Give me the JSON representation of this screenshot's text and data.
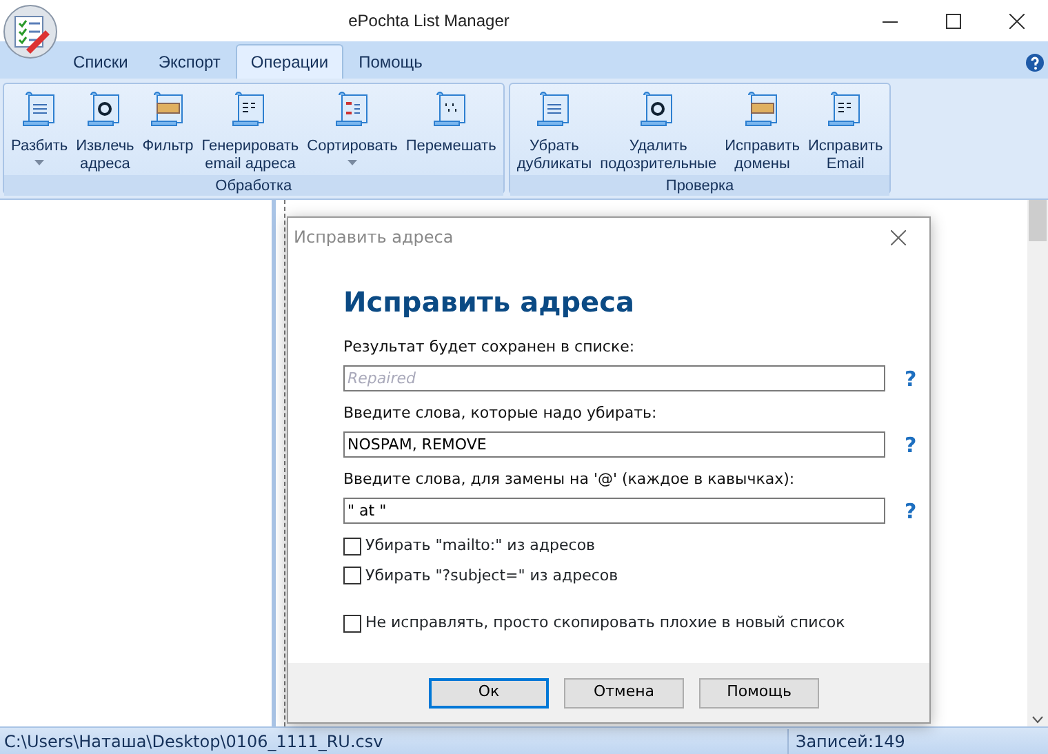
{
  "window": {
    "title": "ePochta List Manager"
  },
  "tabs": [
    {
      "label": "Списки",
      "selected": false
    },
    {
      "label": "Экспорт",
      "selected": false
    },
    {
      "label": "Операции",
      "selected": true
    },
    {
      "label": "Помощь",
      "selected": false
    }
  ],
  "ribbon_groups": [
    {
      "label": "Обработка",
      "buttons": [
        {
          "label": "Разбить",
          "dropdown": true
        },
        {
          "label": "Извлечь\nадреса",
          "dropdown": false
        },
        {
          "label": "Фильтр",
          "dropdown": false
        },
        {
          "label": "Генерировать\nemail адреса",
          "dropdown": false
        },
        {
          "label": "Сортировать",
          "dropdown": true
        },
        {
          "label": "Перемешать",
          "dropdown": false
        }
      ]
    },
    {
      "label": "Проверка",
      "buttons": [
        {
          "label": "Убрать\nдубликаты",
          "dropdown": false
        },
        {
          "label": "Удалить\nподозрительные",
          "dropdown": false
        },
        {
          "label": "Исправить\nдомены",
          "dropdown": false
        },
        {
          "label": "Исправить\nEmail",
          "dropdown": false
        }
      ]
    }
  ],
  "dialog": {
    "title": "Исправить адреса",
    "heading": "Исправить адреса",
    "fields": [
      {
        "label": "Результат будет сохранен в списке:",
        "placeholder": "Repaired",
        "help": "?"
      },
      {
        "label": "Введите слова, которые надо убирать:",
        "value": "NOSPAM, REMOVE",
        "help": "?"
      },
      {
        "label": "Введите слова, для замены на '@' (каждое в кавычках):",
        "value": "\" at \"",
        "help": "?"
      }
    ],
    "checkbox_groups": [
      [
        {
          "label": "Убирать \"mailto:\" из адресов",
          "checked": false
        },
        {
          "label": "Убирать \"?subject=\" из адресов",
          "checked": false
        }
      ],
      [
        {
          "label": "Не исправлять, просто скопировать плохие в новый список",
          "checked": false
        }
      ]
    ],
    "buttons": [
      {
        "label": "Ок",
        "default": true
      },
      {
        "label": "Отмена",
        "default": false
      },
      {
        "label": "Помощь",
        "default": false
      }
    ]
  },
  "status_bar": {
    "path": "C:\\Users\\Наташа\\Desktop\\0106_1111_RU.csv",
    "records": "Записей:149"
  }
}
